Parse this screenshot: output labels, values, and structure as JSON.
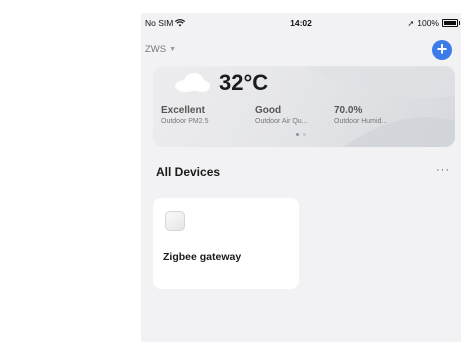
{
  "status_bar": {
    "carrier": "No SIM",
    "time": "14:02",
    "battery": "100%"
  },
  "home": {
    "name": "ZWS"
  },
  "weather": {
    "temperature": "32°C",
    "stats": [
      {
        "value": "Excellent",
        "label": "Outdoor PM2.5"
      },
      {
        "value": "Good",
        "label": "Outdoor Air Qu..."
      },
      {
        "value": "70.0%",
        "label": "Outdoor Humid..."
      }
    ],
    "page_count": 2,
    "active_page": 1
  },
  "devices_section": {
    "title": "All Devices",
    "more_label": "···"
  },
  "devices": [
    {
      "name": "Zigbee gateway",
      "icon": "gateway-icon"
    }
  ],
  "colors": {
    "accent": "#3d7be9",
    "page_bg": "#f2f2f4",
    "card_bg": "#ffffff"
  }
}
